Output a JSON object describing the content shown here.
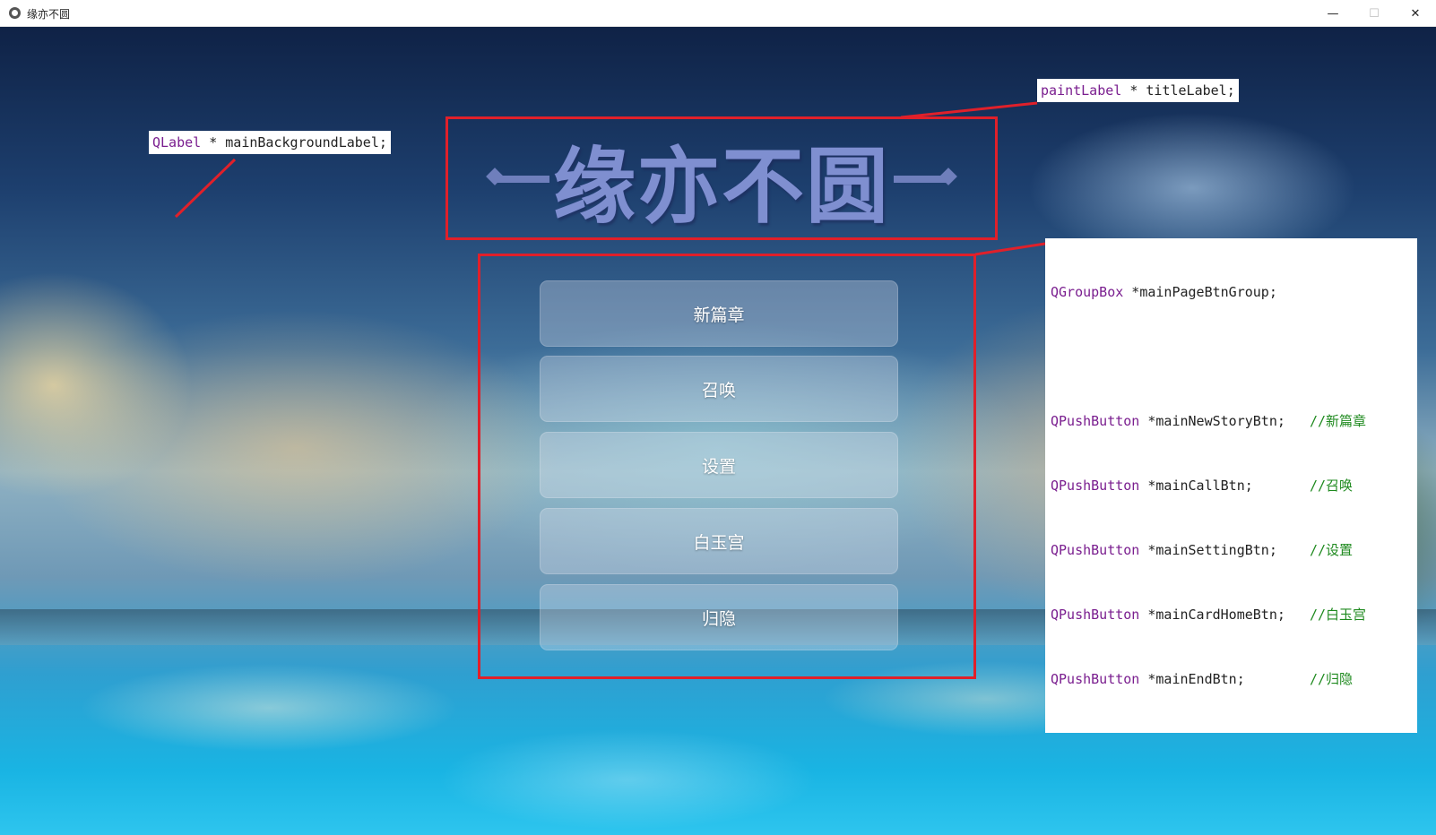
{
  "window": {
    "title": "缘亦不圆",
    "minimize_glyph": "—",
    "maximize_glyph": "☐",
    "close_glyph": "✕"
  },
  "title_art": {
    "text": "缘亦不圆"
  },
  "buttons": [
    {
      "label": "新篇章"
    },
    {
      "label": "召唤"
    },
    {
      "label": "设置"
    },
    {
      "label": "白玉宫"
    },
    {
      "label": "归隐"
    }
  ],
  "annotations": {
    "background_label": {
      "type": "QLabel",
      "rest": " * mainBackgroundLabel;"
    },
    "title_label": {
      "type": "paintLabel",
      "rest": " * titleLabel;"
    },
    "group": {
      "group_type": "QGroupBox",
      "group_rest": " *mainPageBtnGroup;",
      "lines": [
        {
          "type": "QPushButton",
          "rest": " *mainNewStoryBtn;   ",
          "comment": "//新篇章"
        },
        {
          "type": "QPushButton",
          "rest": " *mainCallBtn;       ",
          "comment": "//召唤"
        },
        {
          "type": "QPushButton",
          "rest": " *mainSettingBtn;    ",
          "comment": "//设置"
        },
        {
          "type": "QPushButton",
          "rest": " *mainCardHomeBtn;   ",
          "comment": "//白玉宫"
        },
        {
          "type": "QPushButton",
          "rest": " *mainEndBtn;        ",
          "comment": "//归隐"
        }
      ]
    }
  },
  "colors": {
    "annotation_red": "#e0202a",
    "title_art": "#7f8fd0",
    "keyword_purple": "#7a1e8f",
    "comment_green": "#1f8a1f"
  },
  "icons": [
    "app-icon",
    "minimize-icon",
    "maximize-icon",
    "close-icon"
  ]
}
